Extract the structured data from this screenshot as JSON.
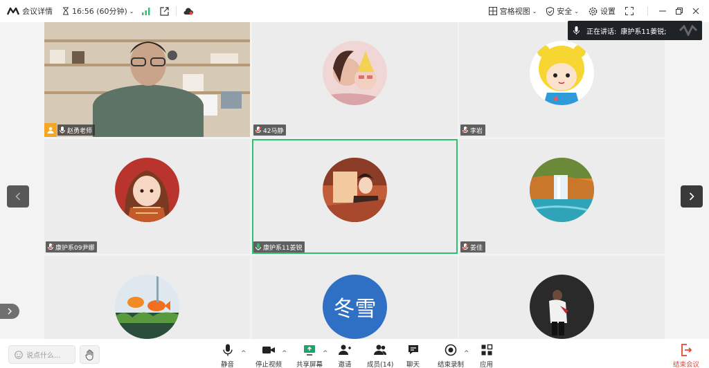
{
  "topbar": {
    "title": "会议详情",
    "time": "16:56 (60分钟)",
    "view_mode": "宫格视图",
    "security": "安全",
    "settings": "设置"
  },
  "speaking": {
    "label": "正在讲话:",
    "name": "康护系11姜锐;"
  },
  "participants": [
    {
      "name": "赵勇老师",
      "role": "host",
      "video": true
    },
    {
      "name": "42马静"
    },
    {
      "name": "李岩"
    },
    {
      "name": "康护系09尹娜"
    },
    {
      "name": "康护系11姜锐",
      "active": true,
      "speaking": true
    },
    {
      "name": "姜佳"
    },
    {
      "name": ""
    },
    {
      "name": "",
      "avatar_text": "冬雪"
    },
    {
      "name": ""
    }
  ],
  "bottombar": {
    "chat_placeholder": "说点什么...",
    "mute": "静音",
    "stop_video": "停止视频",
    "share_screen": "共享屏幕",
    "invite": "邀请",
    "members": "成员(14)",
    "chat": "聊天",
    "end_record": "结束录制",
    "apps": "应用",
    "end_meeting": "结束会议"
  },
  "colors": {
    "active_border": "#2fbf71",
    "end_meeting": "#e8452b",
    "host_badge": "#f5a623",
    "signal": "#2fbf71"
  }
}
